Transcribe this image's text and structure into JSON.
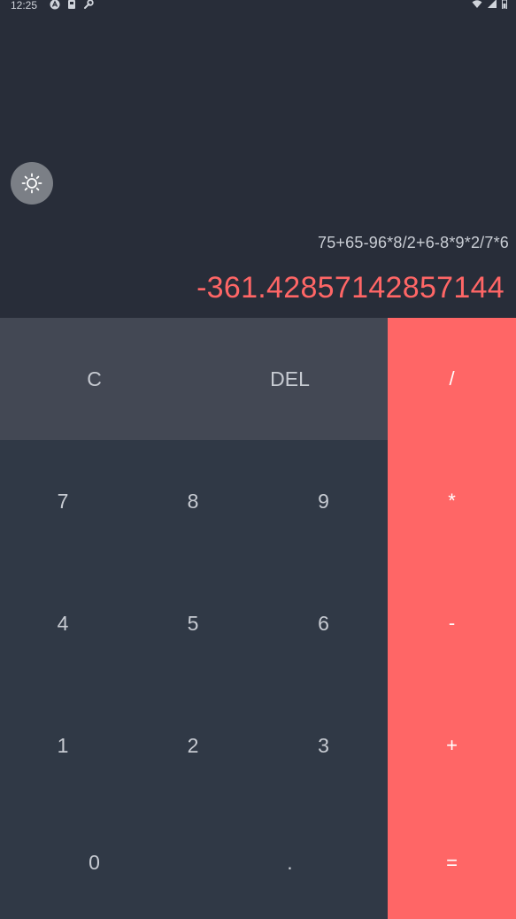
{
  "status_bar": {
    "time": "12:25"
  },
  "display": {
    "expression": "75+65-96*8/2+6-8*9*2/7*6",
    "result": "-361.42857142857144"
  },
  "keys": {
    "clear": "C",
    "delete": "DEL",
    "divide": "/",
    "seven": "7",
    "eight": "8",
    "nine": "9",
    "multiply": "*",
    "four": "4",
    "five": "5",
    "six": "6",
    "minus": "-",
    "one": "1",
    "two": "2",
    "three": "3",
    "plus": "+",
    "zero": "0",
    "decimal": ".",
    "equals": "="
  },
  "colors": {
    "background": "#282d39",
    "accent": "#ff6666",
    "function_row": "#434854",
    "digit_pad": "#303946",
    "theme_toggle": "#7b7f86"
  },
  "icons": {
    "theme_toggle": "sun-icon"
  }
}
